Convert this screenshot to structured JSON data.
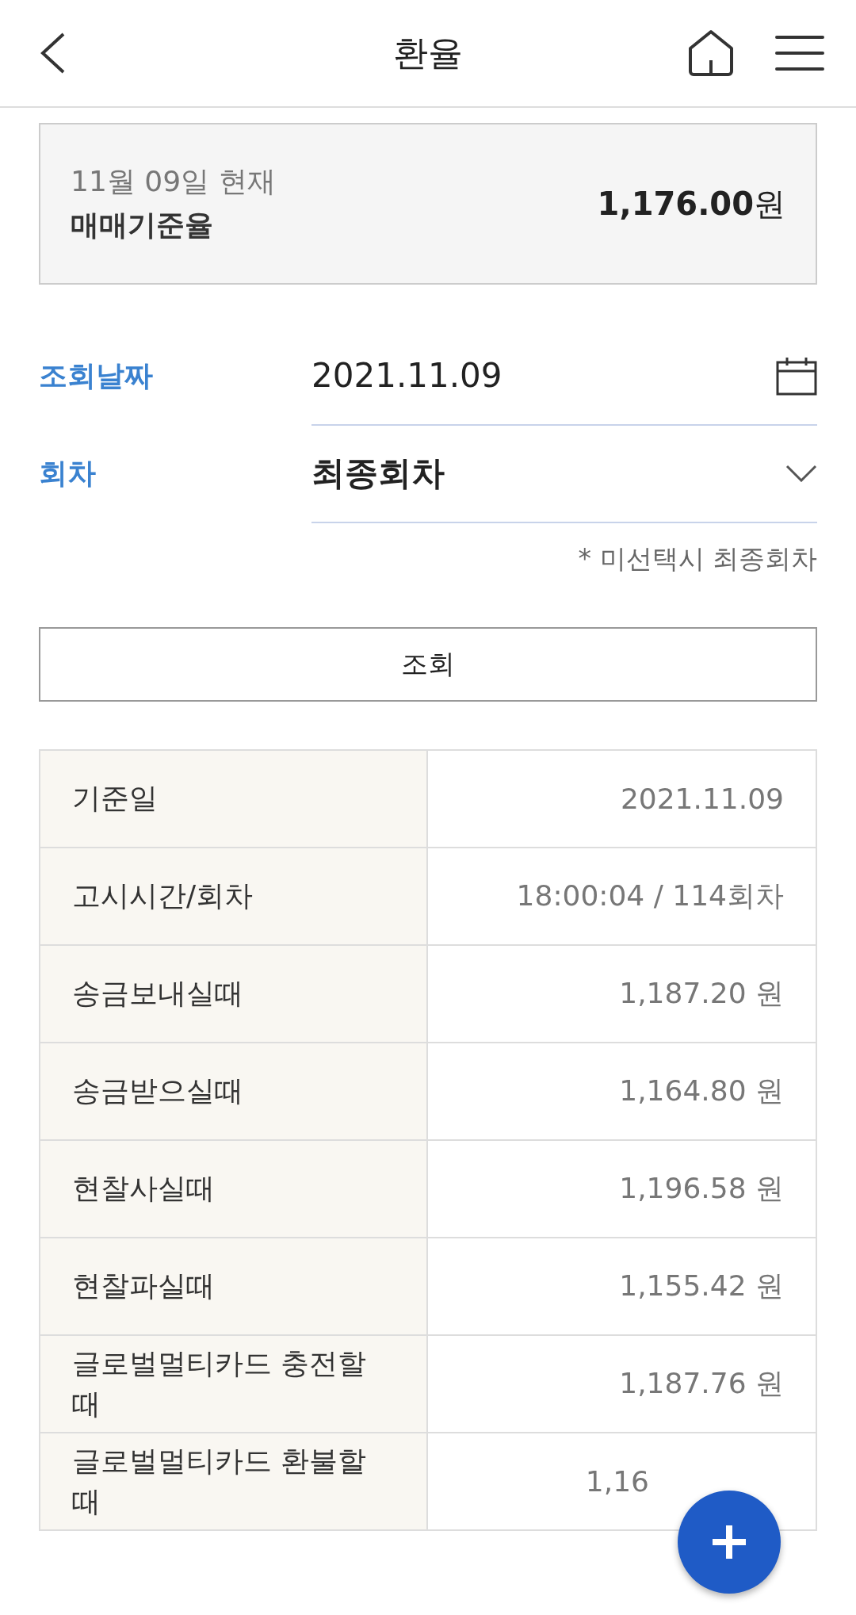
{
  "header": {
    "title": "환율"
  },
  "summary": {
    "date": "11월 09일 현재",
    "label": "매매기준율",
    "amount": "1,176.00",
    "unit": "원"
  },
  "form": [
    {
      "kind": "date",
      "label": "조회날짜",
      "value": "2021.11.09"
    },
    {
      "kind": "select",
      "label": "회차",
      "value": "최종회차"
    }
  ],
  "note": "* 미선택시 최종회차",
  "search_button": "조회",
  "table": {
    "rows": [
      {
        "label": "기준일",
        "value": "2021.11.09"
      },
      {
        "label": "고시시간/회차",
        "value": "18:00:04 / 114회차"
      },
      {
        "label": "송금보내실때",
        "value": "1,187.20 원"
      },
      {
        "label": "송금받으실때",
        "value": "1,164.80 원"
      },
      {
        "label": "현찰사실때",
        "value": "1,196.58 원"
      },
      {
        "label": "현찰파실때",
        "value": "1,155.42 원"
      },
      {
        "label": "글로벌멀티카드 충전할때",
        "value": "1,187.76 원"
      },
      {
        "label": "글로벌멀티카드 환불할때",
        "value": "1,16",
        "covered": true
      }
    ]
  }
}
